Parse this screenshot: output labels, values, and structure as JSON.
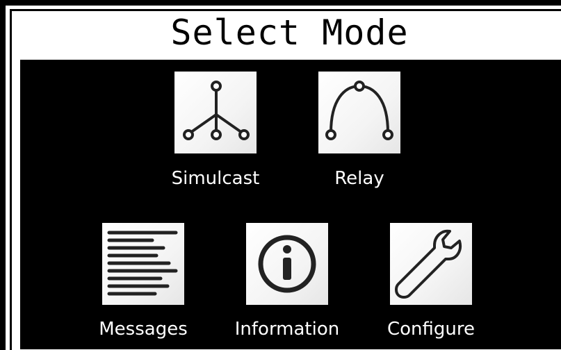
{
  "header": {
    "title": "Select Mode"
  },
  "modes": [
    {
      "label": "Simulcast",
      "icon": "simulcast-tree-icon"
    },
    {
      "label": "Relay",
      "icon": "relay-arc-icon"
    },
    {
      "label": "Messages",
      "icon": "messages-lines-icon"
    },
    {
      "label": "Information",
      "icon": "information-icon"
    },
    {
      "label": "Configure",
      "icon": "wrench-icon"
    }
  ],
  "colors": {
    "background": "#000000",
    "text": "#ffffff",
    "tile": "#ffffff",
    "icon": "#222222"
  }
}
